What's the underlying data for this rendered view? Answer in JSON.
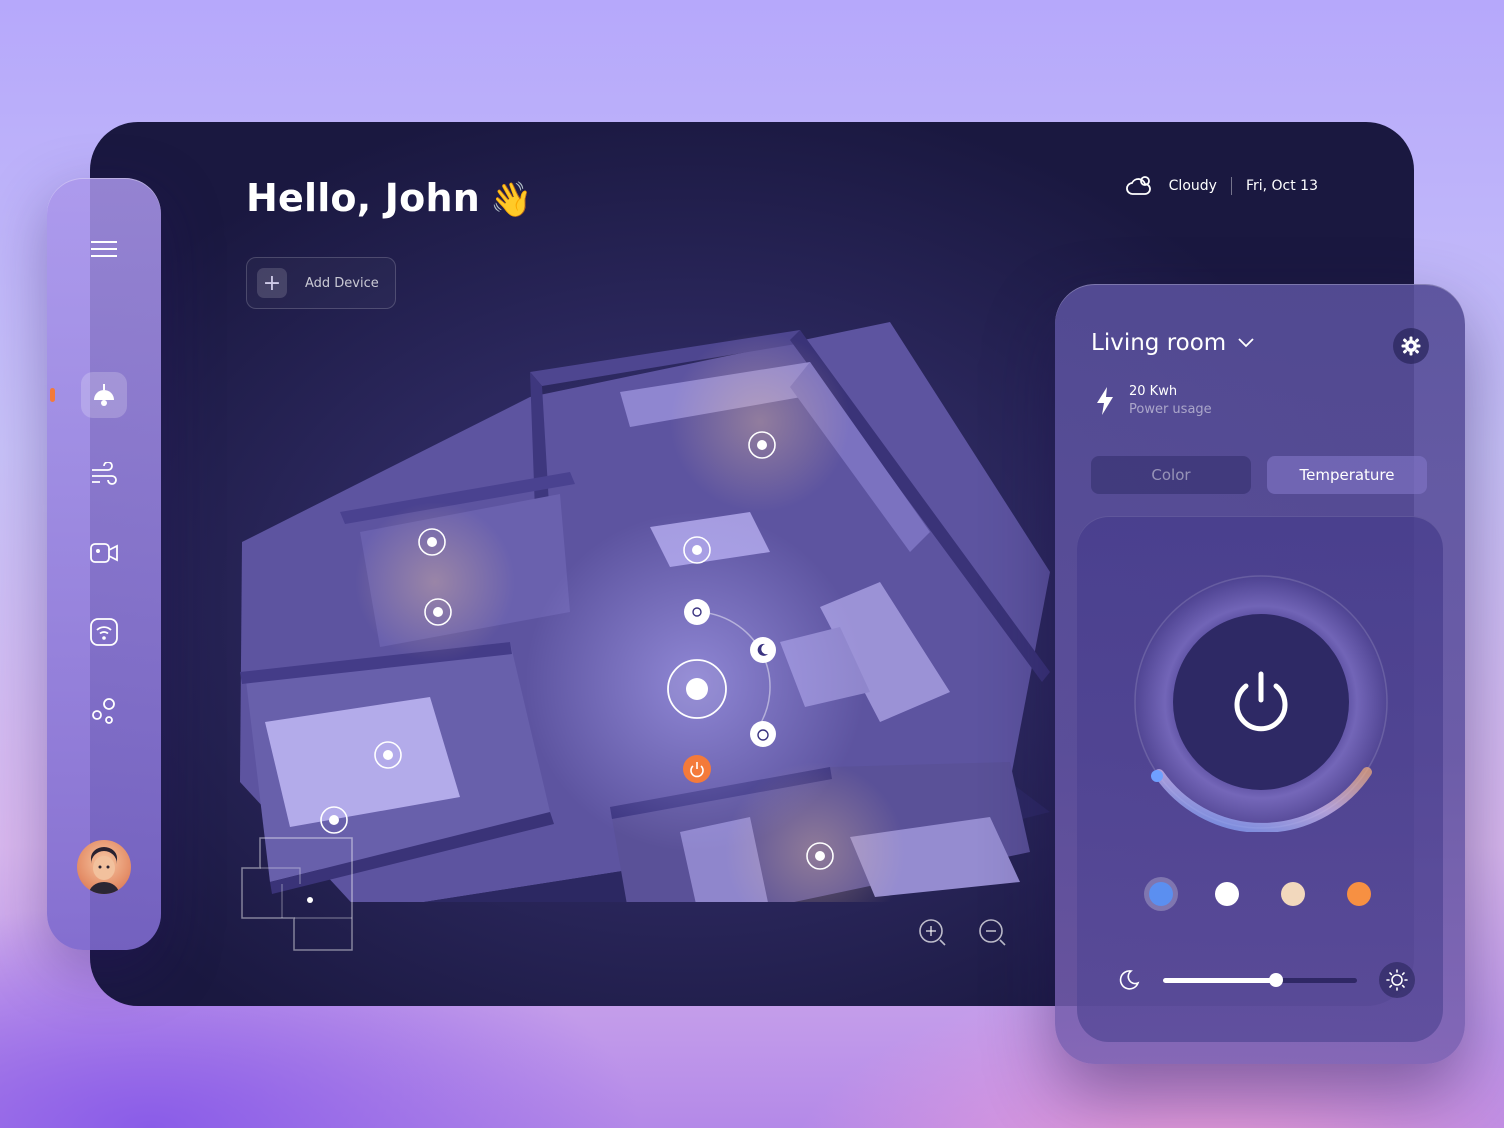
{
  "header": {
    "greeting": "Hello, John",
    "greeting_emoji": "👋",
    "add_device_label": "Add Device",
    "weather": "Cloudy",
    "date": "Fri, Oct 13"
  },
  "sidebar": {
    "active_item": "lighting",
    "items": [
      "menu-icon",
      "lamp-icon",
      "wind-icon",
      "camera-icon",
      "wifi-icon",
      "devices-icon"
    ]
  },
  "panel": {
    "room": "Living room",
    "power_value": "20 Kwh",
    "power_label": "Power usage",
    "tabs": [
      {
        "label": "Color",
        "active": false
      },
      {
        "label": "Temperature",
        "active": true
      }
    ],
    "swatches": [
      {
        "color": "#5b8ff0",
        "selected": true
      },
      {
        "color": "#ffffff",
        "selected": false
      },
      {
        "color": "#f2d8bd",
        "selected": false
      },
      {
        "color": "#f79042",
        "selected": false
      }
    ],
    "brightness_fraction": 0.58
  },
  "colors": {
    "accent_orange": "#f47a3a",
    "dial_blue": "#6fa0ff"
  }
}
